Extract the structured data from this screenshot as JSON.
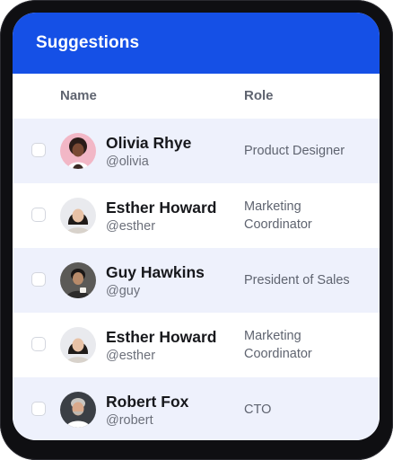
{
  "header": {
    "title": "Suggestions"
  },
  "columns": {
    "name": "Name",
    "role": "Role"
  },
  "rows": [
    {
      "name": "Olivia Rhye",
      "handle": "@olivia",
      "role": "Product Designer",
      "avatar": "woman-avatar-pink"
    },
    {
      "name": "Esther Howard",
      "handle": "@esther",
      "role": "Marketing Coordinator",
      "avatar": "woman-avatar-light"
    },
    {
      "name": "Guy Hawkins",
      "handle": "@guy",
      "role": "President of Sales",
      "avatar": "man-avatar-dark"
    },
    {
      "name": "Esther Howard",
      "handle": "@esther",
      "role": "Marketing Coordinator",
      "avatar": "woman-avatar-light"
    },
    {
      "name": "Robert Fox",
      "handle": "@robert",
      "role": "CTO",
      "avatar": "man-avatar-gray"
    }
  ],
  "colors": {
    "header": "#1550e6",
    "row_alt": "#eef1fc",
    "device_frame": "#0f0f12"
  }
}
